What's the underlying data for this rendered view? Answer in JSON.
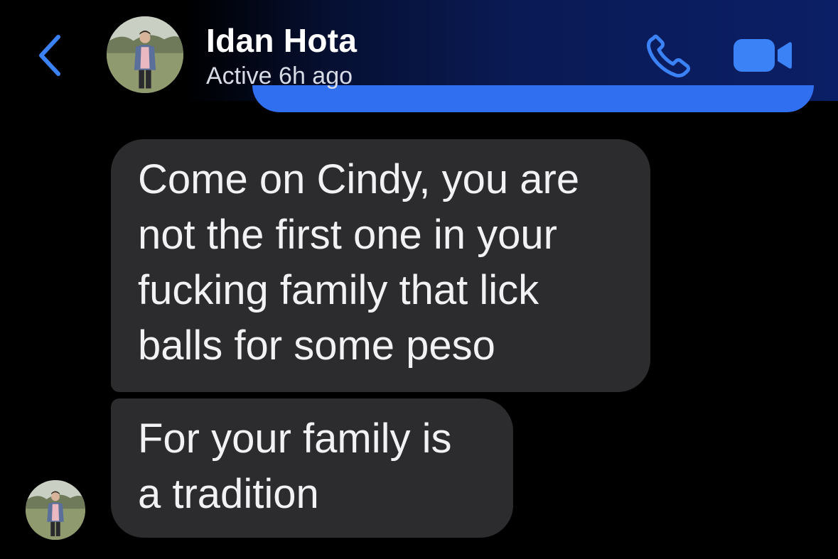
{
  "header": {
    "contact_name": "Idan Hota",
    "status": "Active 6h ago",
    "icons": [
      "back-chevron-icon",
      "phone-icon",
      "video-camera-icon"
    ],
    "accent_color": "#3b82f6"
  },
  "messages": [
    {
      "sender": "Idan Hota",
      "lines": [
        "Come on Cindy, you are",
        "not the first one in your",
        "fucking family that lick",
        "balls for some peso"
      ]
    },
    {
      "sender": "Idan Hota",
      "lines": [
        "For your family is",
        "a tradition"
      ]
    }
  ],
  "colors": {
    "received_bubble": "#2c2c2e",
    "sent_bubble": "#2f6ff0",
    "background": "#000000"
  }
}
